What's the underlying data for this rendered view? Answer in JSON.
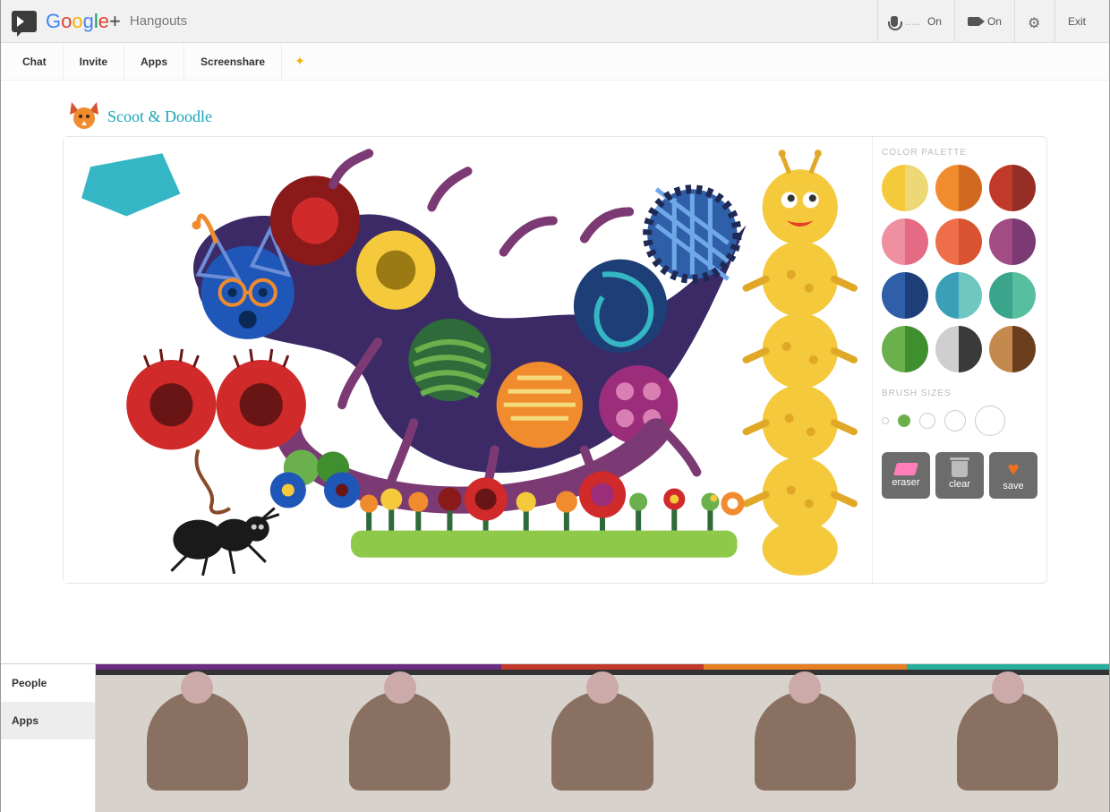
{
  "header": {
    "brand": "Google+",
    "product": "Hangouts",
    "mic_status": "On",
    "mic_prefix": ".....",
    "cam_status": "On",
    "exit": "Exit"
  },
  "subnav": {
    "chat": "Chat",
    "invite": "Invite",
    "apps": "Apps",
    "screenshare": "Screenshare"
  },
  "app": {
    "title": "Scoot & Doodle",
    "panels": {
      "color_label": "COLOR PALETTE",
      "brush_label": "BRUSH SIZES"
    },
    "colors": [
      {
        "left": "#f5c93c",
        "right": "#ecd874"
      },
      {
        "left": "#f08b2e",
        "right": "#d16a1e"
      },
      {
        "left": "#c0392b",
        "right": "#952f25"
      },
      {
        "left": "#f08fa0",
        "right": "#e56b85"
      },
      {
        "left": "#ef6e4a",
        "right": "#d95330"
      },
      {
        "left": "#a24c86",
        "right": "#7b3a73"
      },
      {
        "left": "#2f5fa8",
        "right": "#1e3e77"
      },
      {
        "left": "#3aa0b8",
        "right": "#6fc7c2"
      },
      {
        "left": "#3aa58a",
        "right": "#57bfa0"
      },
      {
        "left": "#6ab04c",
        "right": "#3f8f2f"
      },
      {
        "left": "#cfcfcf",
        "right": "#3a3a3a"
      },
      {
        "left": "#c48a4d",
        "right": "#6b3f1d"
      }
    ],
    "brush_sizes": [
      8,
      14,
      18,
      24,
      34
    ],
    "brush_selected_index": 1,
    "actions": {
      "eraser": "eraser",
      "clear": "clear",
      "save": "save"
    }
  },
  "bottom": {
    "people": "People",
    "apps": "Apps",
    "active_tab": "apps",
    "participants": [
      {
        "accent": "#6a2d82"
      },
      {
        "accent": "#6a2d82"
      },
      {
        "accent": "#c0392b"
      },
      {
        "accent": "#e67e22"
      },
      {
        "accent": "#27ae9c"
      }
    ]
  }
}
